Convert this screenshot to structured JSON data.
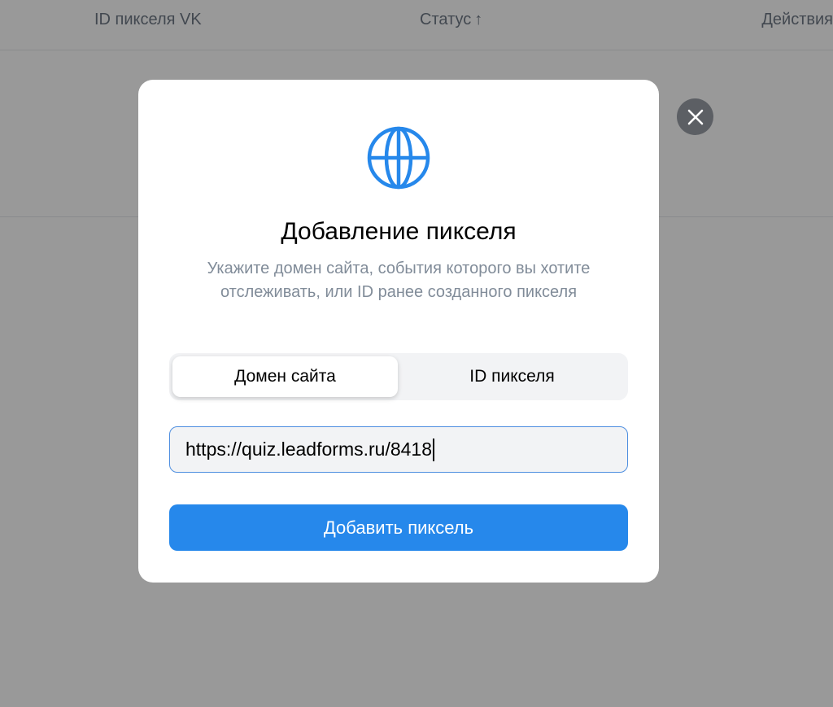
{
  "table": {
    "columns": {
      "pixel_id": "ID пикселя VK",
      "status": "Статус",
      "status_sort": "↑",
      "actions": "Действия"
    }
  },
  "modal": {
    "icon": "globe-icon",
    "title": "Добавление пикселя",
    "subtitle": "Укажите домен сайта, события которого вы хотите отслеживать, или ID ранее созданного пикселя",
    "tabs": [
      {
        "label": "Домен сайта",
        "selected": true
      },
      {
        "label": "ID пикселя",
        "selected": false
      }
    ],
    "input": {
      "value": "https://quiz.leadforms.ru/8418"
    },
    "submit_label": "Добавить пиксель",
    "close_icon": "close-icon"
  },
  "colors": {
    "accent": "#2688eb",
    "globe": "#2688eb",
    "overlay": "rgba(0,0,0,0.40)"
  }
}
